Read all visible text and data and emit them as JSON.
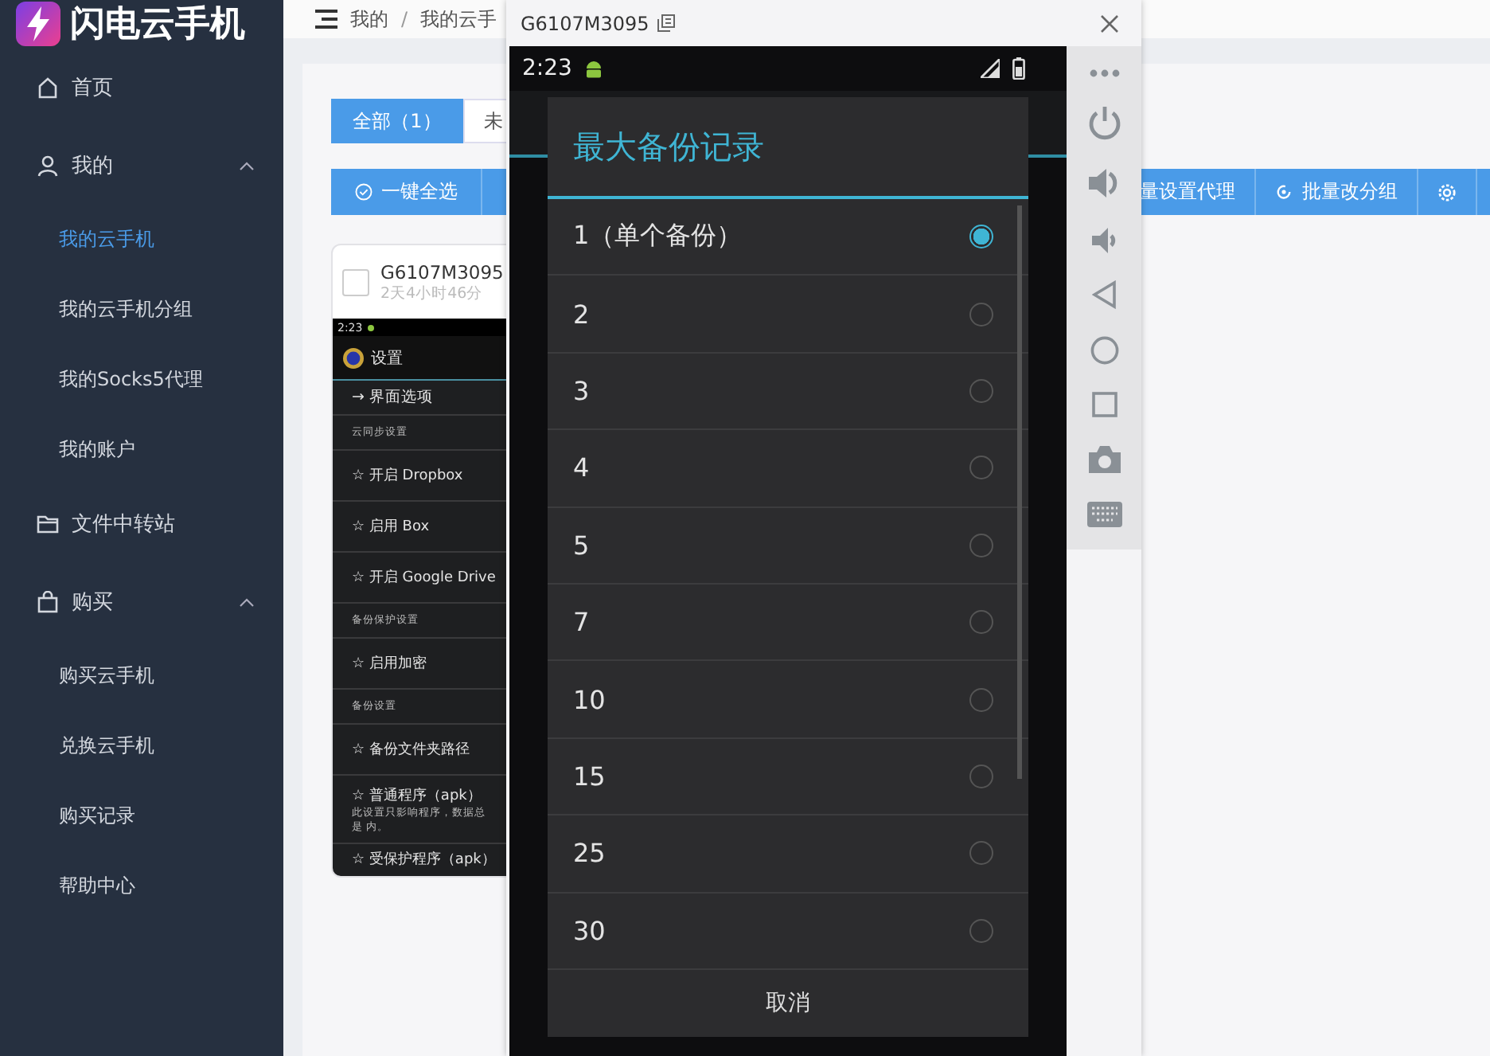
{
  "sidebar": {
    "logo": "闪电云手机",
    "items": [
      {
        "label": "首页",
        "selected": false
      },
      {
        "label": "我的",
        "selected": false,
        "expanded": true,
        "children": [
          {
            "label": "我的云手机",
            "selected": true
          },
          {
            "label": "我的云手机分组",
            "selected": false
          },
          {
            "label": "我的Socks5代理",
            "selected": false
          },
          {
            "label": "我的账户",
            "selected": false
          }
        ]
      },
      {
        "label": "文件中转站",
        "selected": false
      },
      {
        "label": "购买",
        "selected": false,
        "expanded": true,
        "children": [
          {
            "label": "购买云手机",
            "selected": false
          },
          {
            "label": "兑换云手机",
            "selected": false
          },
          {
            "label": "购买记录",
            "selected": false
          },
          {
            "label": "帮助中心",
            "selected": false
          }
        ]
      }
    ]
  },
  "breadcrumb": [
    "我的",
    "我的云手"
  ],
  "breadcrumb_separator": "/",
  "tabs": [
    {
      "label": "全部（1）",
      "selected": true
    },
    {
      "label": "未",
      "selected": false
    }
  ],
  "toolbar": {
    "left": [
      "一键全选"
    ],
    "right": [
      "量设置代理",
      "批量改分组"
    ]
  },
  "phone_card": {
    "name": "G6107M3095",
    "checked": false,
    "uptime": "2天4小时46分",
    "screen": {
      "time": "2:23",
      "title": "设置",
      "rows": [
        {
          "kind": "link",
          "text": "→ 界面选项"
        },
        {
          "kind": "section",
          "text": "云同步设置"
        },
        {
          "kind": "item",
          "text": "☆ 开启 Dropbox"
        },
        {
          "kind": "item",
          "text": "☆ 启用 Box"
        },
        {
          "kind": "item",
          "text": "☆ 开启 Google Drive"
        },
        {
          "kind": "section",
          "text": "备份保护设置"
        },
        {
          "kind": "item",
          "text": "☆ 启用加密"
        },
        {
          "kind": "section",
          "text": "备份设置"
        },
        {
          "kind": "item",
          "text": "☆ 备份文件夹路径"
        },
        {
          "kind": "item",
          "text": "☆ 普通程序（apk）",
          "note": "此设置只影响程序，数据总是 内。"
        },
        {
          "kind": "item",
          "text": "☆ 受保护程序（apk）"
        }
      ]
    }
  },
  "popup": {
    "title": "G6107M3095",
    "time": "2:23",
    "dialog": {
      "title": "最大备份记录",
      "options": [
        {
          "label": "1（单个备份）",
          "selected": true
        },
        {
          "label": "2",
          "selected": false
        },
        {
          "label": "3",
          "selected": false
        },
        {
          "label": "4",
          "selected": false
        },
        {
          "label": "5",
          "selected": false
        },
        {
          "label": "7",
          "selected": false
        },
        {
          "label": "10",
          "selected": false
        },
        {
          "label": "15",
          "selected": false
        },
        {
          "label": "25",
          "selected": false
        },
        {
          "label": "30",
          "selected": false
        }
      ],
      "cancel": "取消"
    }
  }
}
